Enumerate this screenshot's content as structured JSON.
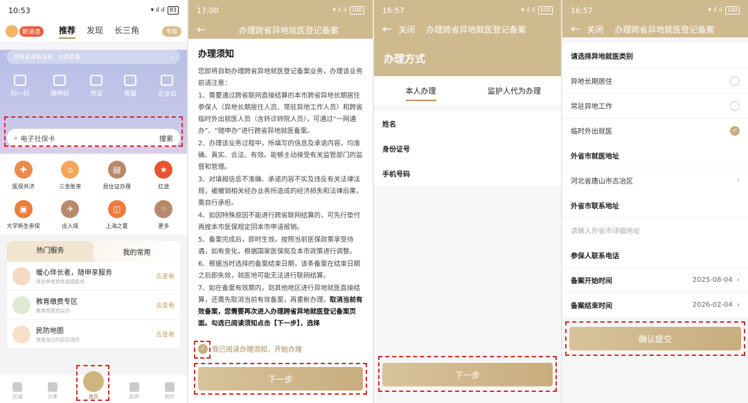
{
  "p1": {
    "time": "10:53",
    "battery": "83",
    "msg": "新消息",
    "tabs": [
      "推荐",
      "发现",
      "长三角"
    ],
    "zhuanban": "专版",
    "notice": "您有未读新消息，立即查看",
    "quick": [
      "扫一扫",
      "随申码",
      "亮证",
      "客服",
      "企业云"
    ],
    "search_placeholder": "电子社保卡",
    "search_btn": "搜索",
    "grid": [
      {
        "label": "医保共济",
        "color": "#ec8a4d"
      },
      {
        "label": "三金账单",
        "color": "#f3a55a"
      },
      {
        "label": "居住证办理",
        "color": "#b98a6a"
      },
      {
        "label": "红途",
        "color": "#e8552e"
      },
      {
        "label": "大学新生参保",
        "color": "#ef7a3a"
      },
      {
        "label": "出入境",
        "color": "#b98a6a"
      },
      {
        "label": "上海之夏",
        "color": "#ef7a3a"
      },
      {
        "label": "更多",
        "color": "#b98a6a"
      }
    ],
    "svc_tabs": [
      "热门服务",
      "我的常用"
    ],
    "svc": [
      {
        "title": "暖心伴长者，随申享服务",
        "sub": "体验养老助老便捷服务",
        "go": "去查看"
      },
      {
        "title": "教育缴费专区",
        "sub": "教育缴费指尖办",
        "go": "去查看"
      },
      {
        "title": "民防地图",
        "sub": "查查身边的民防场所",
        "go": "去查看"
      }
    ],
    "tabbar": [
      "区域",
      "办事",
      "首页",
      "民声",
      "我的"
    ]
  },
  "p2": {
    "time": "17:00",
    "battery": "100",
    "title": "办理跨省异地就医登记备案",
    "h": "办理须知",
    "intro": "您即将自助办理跨省异地就医登记备案业务，办理该业务前请注意：",
    "items": [
      "1、需要通过跨省联网直接结算的本市跨省异地长期居住参保人（异地长期居住人员、常驻异地工作人员）和跨省临时外出就医人员（含转诊转院人员），可通过“一网通办”、“随申办”进行跨省异地就医备案。",
      "2、办理该业务过程中，所填写的信息及承诺内容，均准确、真实、合法、有效。能够主动接受有关监管部门的监督和管理。",
      "3、对填报信息不准确、承诺内容不实及违反有关法律法规，被撤销相关经办业务所造成的经济损失和法律后果，需自行承担。",
      "4、如因特殊原因不能进行跨省联网结算的，可先行垫付再按本市医保规定回本市申请报销。",
      "5、备案完成后，即时生效。按照当前医保政策享受待遇，如有变化，根据国家医保局及本市政策进行调整。",
      "6、根据当时选择的备案结束日期，该条备案在结束日期之后即失效，就医地可能无法进行联网结算。"
    ],
    "item7a": "7、如在备案有效期内，到其他地区进行异地就医直接结算，还需先取消当前有效备案，再重新办理。",
    "item7b": "取消当前有效备案，您需要再次进入办理跨省异地就医登记备案页面。勾选已阅读须知点击【下一步】，选择",
    "agree": "我已阅读办理须知，开始办理",
    "next": "下一步"
  },
  "p3": {
    "time": "16:57",
    "battery": "100",
    "close": "关闭",
    "title": "办理跨省异地就医登记备案",
    "h": "办理方式",
    "modes": [
      "本人办理",
      "监护人代为办理"
    ],
    "fields": [
      "姓名",
      "身份证号",
      "手机号码"
    ],
    "next": "下一步"
  },
  "p4": {
    "time": "16:57",
    "battery": "100",
    "close": "关闭",
    "title": "办理跨省异地就医登记备案",
    "cat_label": "请选择异地就医类别",
    "cats": [
      "异地长期居住",
      "常驻异地工作",
      "临时外出就医"
    ],
    "addr_label": "外省市就医地址",
    "addr_val": "河北省唐山市古冶区",
    "contact_label": "外省市联系地址",
    "contact_ph": "请输入外省市详细地址",
    "phone_label": "参保人联系电话",
    "start_label": "备案开始时间",
    "start_val": "2025-08-04",
    "end_label": "备案结束时间",
    "end_val": "2026-02-04",
    "submit": "确认提交"
  },
  "colors": {
    "accent": "#cfb98e",
    "highlight": "#d62a2a"
  }
}
